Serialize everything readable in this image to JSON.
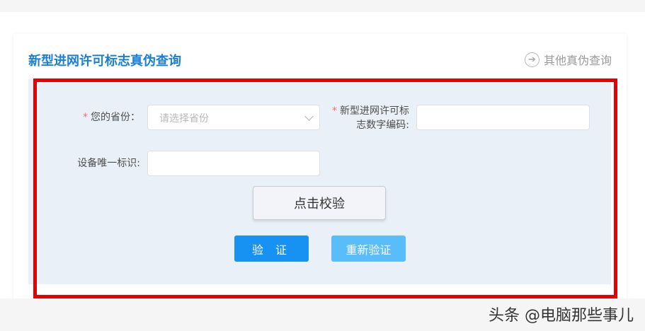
{
  "header": {
    "title": "新型进网许可标志真伪查询",
    "other_link_label": "其他真伪查询",
    "other_link_icon": "arrow-right-circle-icon"
  },
  "form": {
    "province": {
      "required_mark": "*",
      "label": "您的省份：",
      "placeholder": "请选择省份"
    },
    "code": {
      "required_mark": "*",
      "label_line1": "新型进网许可标",
      "label_line2": "志数字编码:",
      "value": ""
    },
    "device_id": {
      "label": "设备唯一标识:",
      "value": ""
    },
    "check_button": "点击校验",
    "verify_button": "验 证",
    "reverify_button": "重新验证"
  },
  "watermark": "头条 @电脑那些事儿",
  "colors": {
    "title": "#1a7fd6",
    "panel_bg": "#e9f0f7",
    "highlight_frame": "#e60000",
    "verify_button": "#1791f2",
    "reverify_button": "#58bdf9",
    "required": "#f56c6c"
  }
}
